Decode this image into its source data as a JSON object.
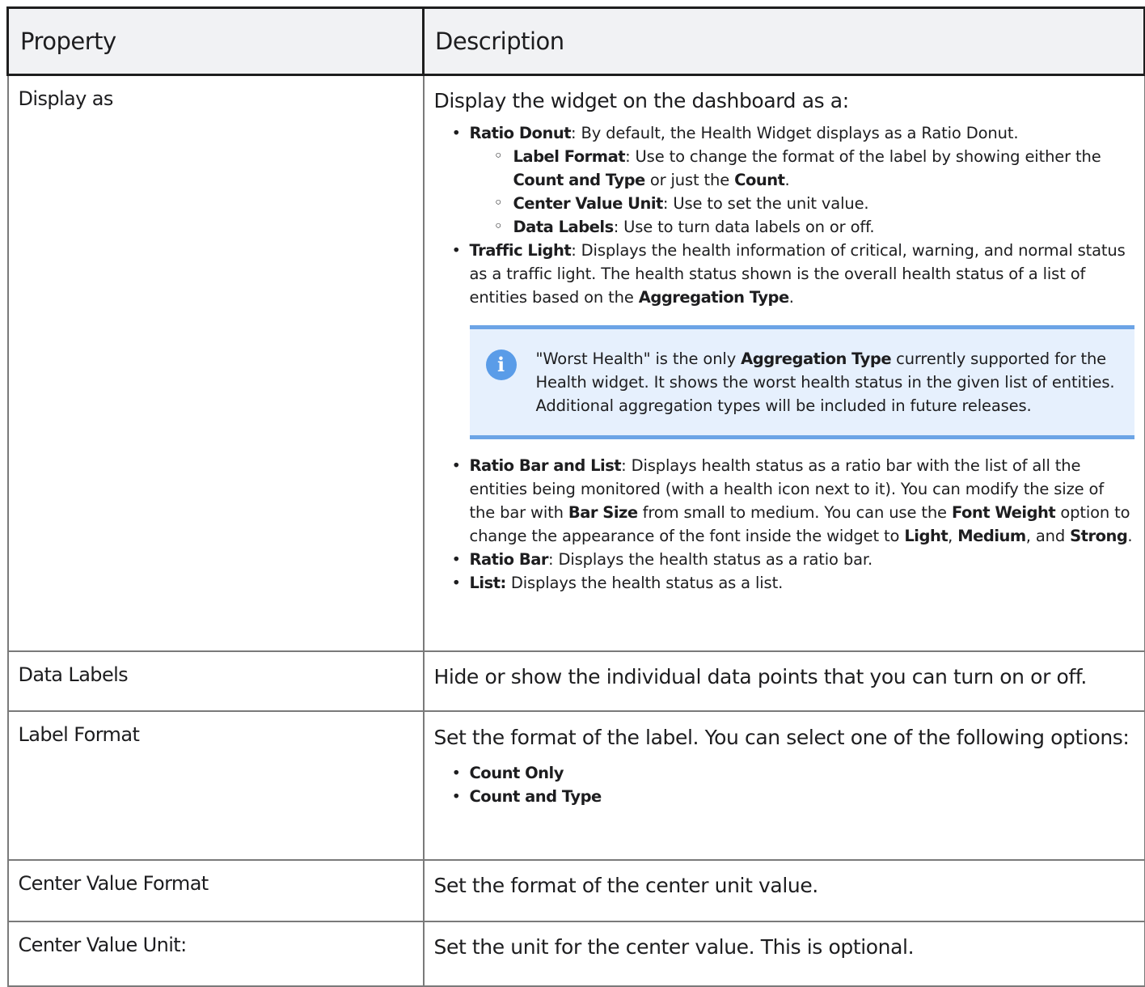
{
  "table": {
    "header": {
      "property": "Property",
      "description": "Description"
    },
    "rows": {
      "display_as": {
        "property": "Display as",
        "lead": "Display the widget on the dashboard as a:",
        "ratio_donut": {
          "term": "Ratio Donut",
          "text": ": By default, the Health Widget displays as a Ratio Donut.",
          "sub": {
            "label_format": {
              "term": "Label Format",
              "text_a": ": Use to change the format of the label by showing either the ",
              "bold_b": "Count and Type",
              "text_c": " or just the ",
              "bold_d": "Count",
              "text_e": "."
            },
            "center_value_unit": {
              "term": "Center Value Unit",
              "text": ": Use to set the unit value."
            },
            "data_labels": {
              "term": "Data Labels",
              "text": ": Use to turn data labels on or off."
            }
          }
        },
        "traffic_light": {
          "term": "Traffic Light",
          "text_a": ": Displays the health information of critical, warning, and normal status as a traffic light. The health status shown is the overall health status of a list of entities based on the ",
          "bold_b": "Aggregation Type",
          "text_c": "."
        },
        "note": {
          "icon": "info-icon",
          "icon_glyph": "i",
          "text_a": "\"Worst Health\" is the only ",
          "bold_b": "Aggregation Type",
          "text_c": " currently supported for the Health widget. It shows the worst health status in the given list of entities. Additional aggregation types will be included in future releases."
        },
        "ratio_bar_and_list": {
          "term": "Ratio Bar and List",
          "text_a": ": Displays health status as a ratio bar with the list of all the entities being monitored (with a health icon next to it). You can modify the size of the bar with ",
          "bold_b": "Bar Size",
          "text_c": " from small to medium. You can use the ",
          "bold_d": "Font Weight",
          "text_e": " option to change the appearance of the font inside the widget to ",
          "bold_f": "Light",
          "text_g": ", ",
          "bold_h": "Medium",
          "text_i": ", and ",
          "bold_j": "Strong",
          "text_k": "."
        },
        "ratio_bar": {
          "term": "Ratio Bar",
          "text": ": Displays the health status as a ratio bar."
        },
        "list": {
          "term": "List:",
          "text": " Displays the health status as a list."
        }
      },
      "data_labels": {
        "property": "Data Labels",
        "description": "Hide or show the individual data points that you can turn on or off."
      },
      "label_format": {
        "property": "Label Format",
        "lead": "Set the format of the label. You can select one of the following options:",
        "options": [
          "Count Only",
          "Count and Type"
        ]
      },
      "center_value_format": {
        "property": "Center Value Format",
        "description": "Set the format of the center unit value."
      },
      "center_value_unit": {
        "property": "Center Value Unit",
        "property_suffix": ":",
        "description": "Set the unit for the center value. This is optional."
      }
    }
  }
}
